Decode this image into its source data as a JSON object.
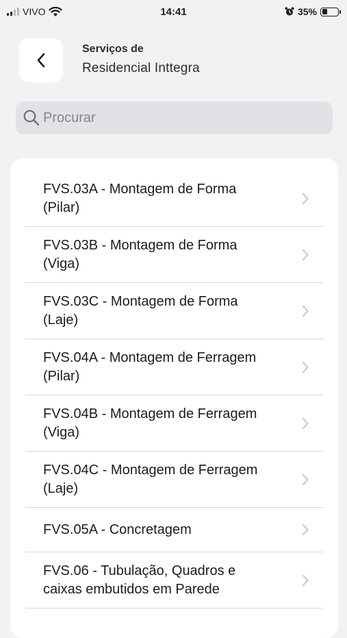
{
  "status_bar": {
    "carrier": "VIVO",
    "time": "14:41",
    "battery_percent": "35%",
    "battery_level": 0.35
  },
  "header": {
    "back_icon": "chevron-left-icon",
    "small_title": "Serviços de",
    "title": "Residencial Inttegra"
  },
  "search": {
    "placeholder": "Procurar",
    "value": ""
  },
  "services": [
    {
      "line1": "FVS.03A - Montagem de Forma",
      "line2": "(Pilar)"
    },
    {
      "line1": "FVS.03B - Montagem de Forma",
      "line2": "(Viga)"
    },
    {
      "line1": "FVS.03C - Montagem de Forma",
      "line2": "(Laje)"
    },
    {
      "line1": "FVS.04A - Montagem de Ferragem",
      "line2": "(Pilar)"
    },
    {
      "line1": "FVS.04B - Montagem de Ferragem",
      "line2": "(Viga)"
    },
    {
      "line1": "FVS.04C - Montagem de Ferragem",
      "line2": "(Laje)"
    },
    {
      "line1": "FVS.05A - Concretagem",
      "line2": ""
    },
    {
      "line1": "FVS.06 - Tubulação, Quadros e",
      "line2": "caixas embutidos em Parede"
    }
  ],
  "colors": {
    "background": "#f2f2f4",
    "card": "#ffffff",
    "search_bg": "#e2e2e6",
    "chevron": "#c4c4c8"
  }
}
